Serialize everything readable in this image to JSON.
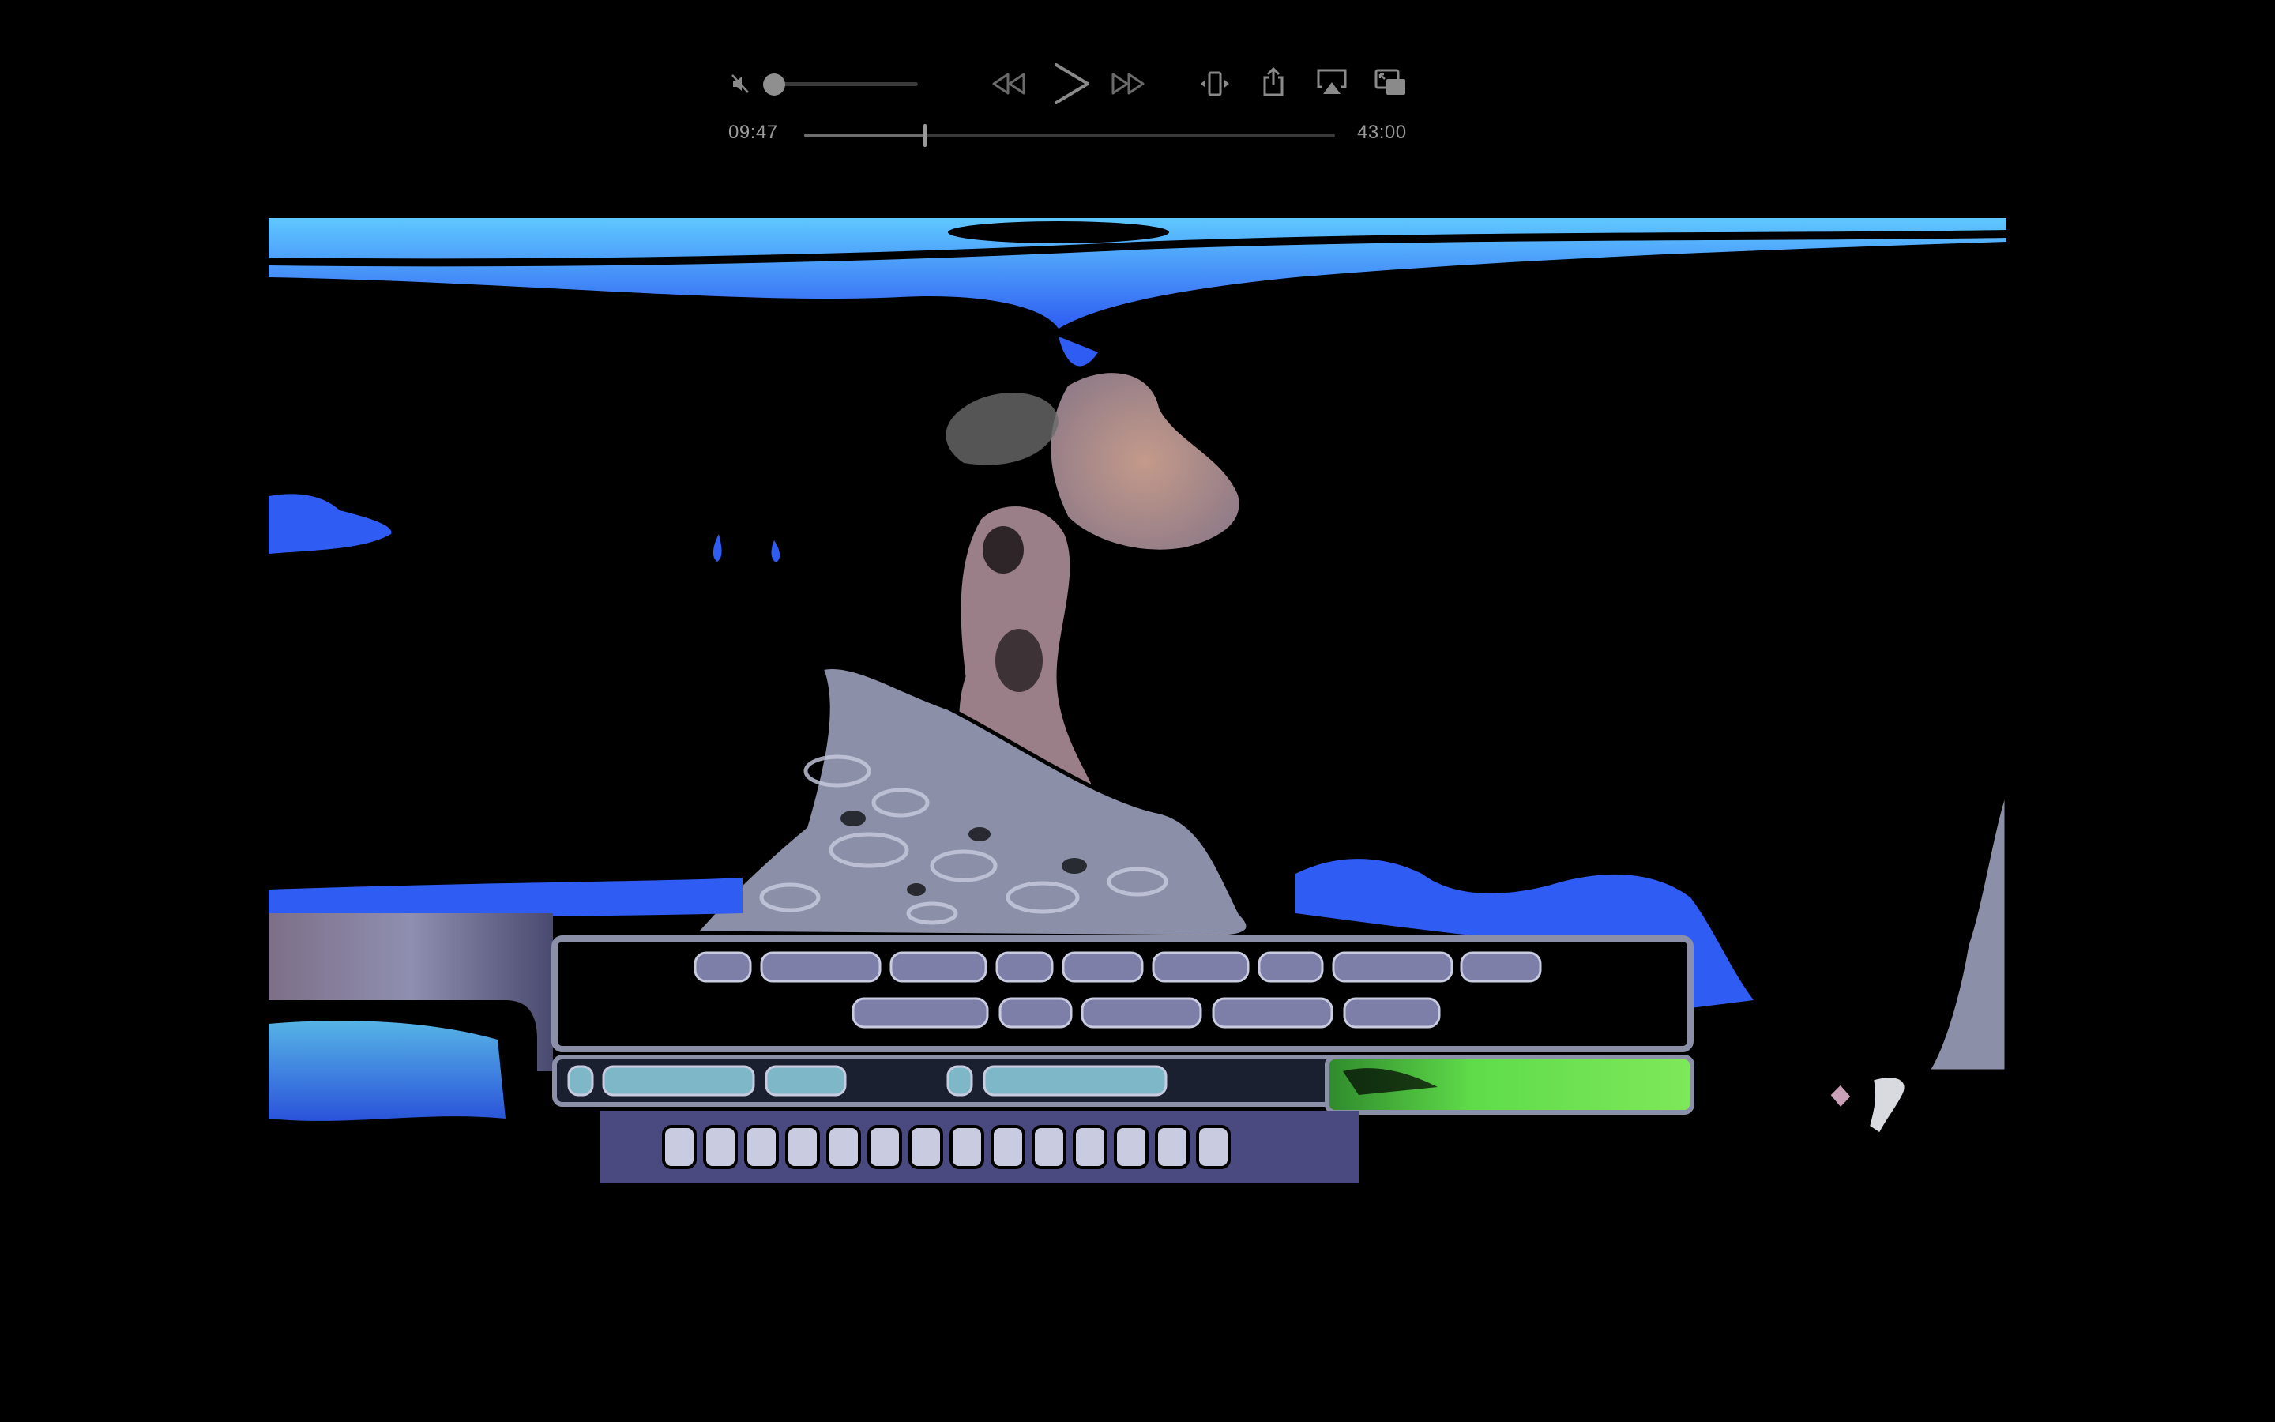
{
  "player": {
    "elapsed_time": "09:47",
    "total_time": "43:00",
    "playback_progress": 0.228,
    "volume_level": 0.0,
    "muted": true,
    "state": "paused"
  },
  "icons": {
    "mute": "speaker-muted-icon",
    "rewind": "rewind-icon",
    "play": "play-icon",
    "fast_forward": "fast-forward-icon",
    "fit": "fit-to-window-icon",
    "share": "share-icon",
    "airplay": "airplay-icon",
    "pip": "picture-in-picture-icon"
  },
  "colors": {
    "background": "#000000",
    "control_gray": "#8a8a8a",
    "track_gray": "#3a3a3a",
    "frame_blue": "#2f5cf2",
    "frame_cyan": "#6fd0ff",
    "frame_green": "#5fdc4a"
  }
}
